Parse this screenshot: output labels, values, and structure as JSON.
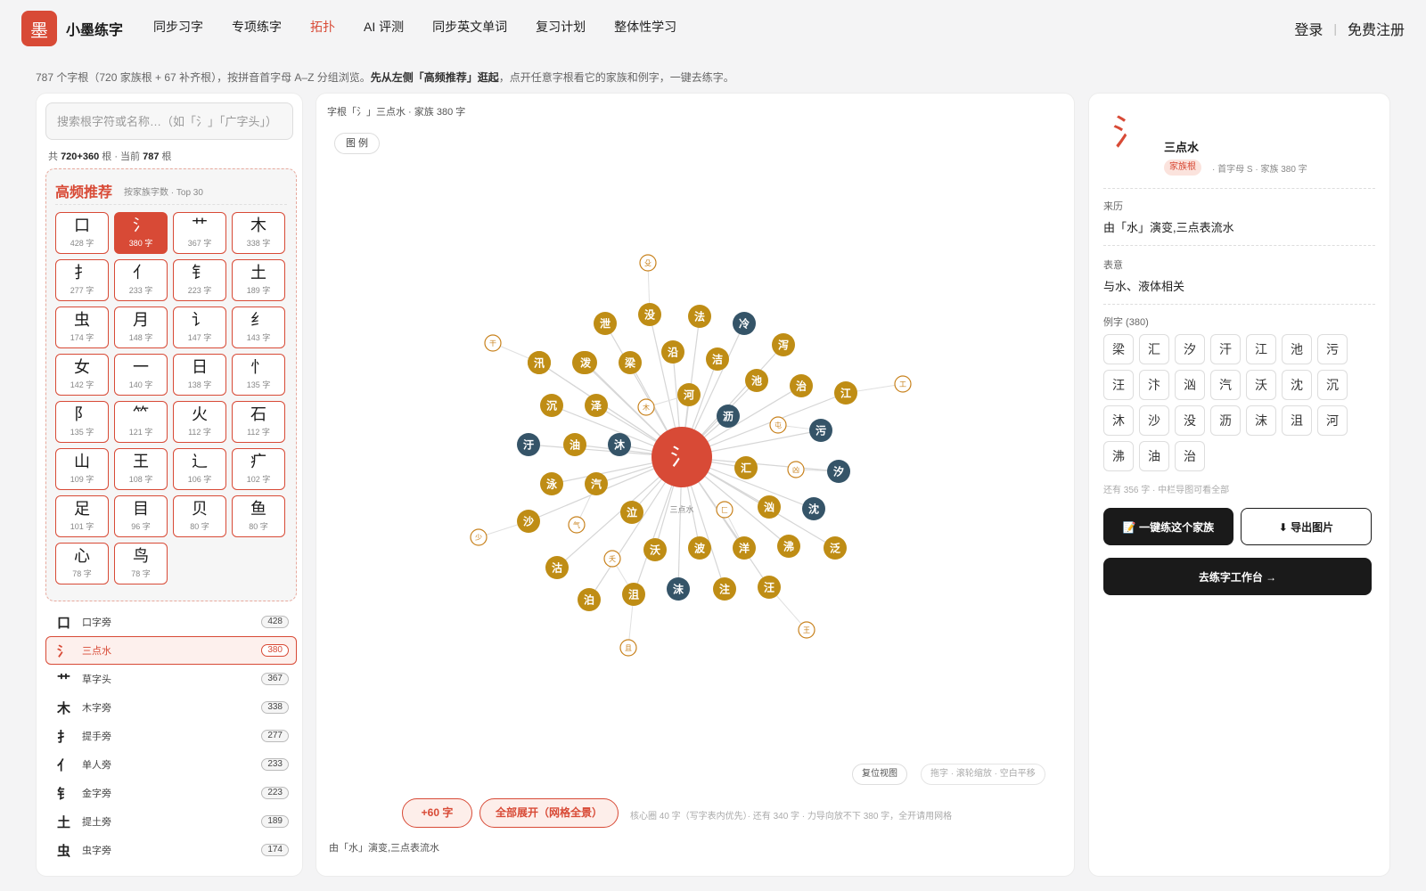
{
  "header": {
    "logo_char": "墨",
    "brand": "小墨练字",
    "nav": [
      "同步习字",
      "专项练字",
      "拓扑",
      "AI 评测",
      "同步英文单词",
      "复习计划",
      "整体性学习"
    ],
    "active_nav": "拓扑",
    "login": "登录",
    "separator": "|",
    "register": "免费注册"
  },
  "intro": {
    "pre": "787 个字根（720 家族根 + 67 补齐根），按拼音首字母 A–Z 分组浏览。",
    "bold": "先从左侧「高频推荐」逛起",
    "post": "，点开任意字根看它的家族和例字，一键去练字。"
  },
  "left": {
    "search_placeholder": "搜索根字符或名称…（如「氵」「广字头」）",
    "count_pre": "共 ",
    "count_total": "720+360",
    "count_mid": " 根 · 当前 ",
    "count_current": "787",
    "count_post": " 根",
    "hot_title": "高频推荐",
    "hot_sub": "按家族字数 · Top 30",
    "hot_items": [
      {
        "ch": "口",
        "count": "428 字"
      },
      {
        "ch": "氵",
        "count": "380 字",
        "selected": true
      },
      {
        "ch": "艹",
        "count": "367 字"
      },
      {
        "ch": "木",
        "count": "338 字"
      },
      {
        "ch": "扌",
        "count": "277 字"
      },
      {
        "ch": "亻",
        "count": "233 字"
      },
      {
        "ch": "钅",
        "count": "223 字"
      },
      {
        "ch": "土",
        "count": "189 字"
      },
      {
        "ch": "虫",
        "count": "174 字"
      },
      {
        "ch": "月",
        "count": "148 字"
      },
      {
        "ch": "讠",
        "count": "147 字"
      },
      {
        "ch": "纟",
        "count": "143 字"
      },
      {
        "ch": "女",
        "count": "142 字"
      },
      {
        "ch": "一",
        "count": "140 字"
      },
      {
        "ch": "日",
        "count": "138 字"
      },
      {
        "ch": "忄",
        "count": "135 字"
      },
      {
        "ch": "阝",
        "count": "135 字"
      },
      {
        "ch": "⺮",
        "count": "121 字"
      },
      {
        "ch": "火",
        "count": "112 字"
      },
      {
        "ch": "石",
        "count": "112 字"
      },
      {
        "ch": "山",
        "count": "109 字"
      },
      {
        "ch": "王",
        "count": "108 字"
      },
      {
        "ch": "辶",
        "count": "106 字"
      },
      {
        "ch": "疒",
        "count": "102 字"
      },
      {
        "ch": "足",
        "count": "101 字"
      },
      {
        "ch": "目",
        "count": "96 字"
      },
      {
        "ch": "贝",
        "count": "80 字"
      },
      {
        "ch": "鱼",
        "count": "80 字"
      },
      {
        "ch": "心",
        "count": "78 字"
      },
      {
        "ch": "鸟",
        "count": "78 字"
      }
    ],
    "radicals": [
      {
        "glyph": "口",
        "name": "口字旁",
        "count": "428"
      },
      {
        "glyph": "氵",
        "name": "三点水",
        "count": "380",
        "selected": true
      },
      {
        "glyph": "艹",
        "name": "草字头",
        "count": "367"
      },
      {
        "glyph": "木",
        "name": "木字旁",
        "count": "338"
      },
      {
        "glyph": "扌",
        "name": "提手旁",
        "count": "277"
      },
      {
        "glyph": "亻",
        "name": "单人旁",
        "count": "233"
      },
      {
        "glyph": "钅",
        "name": "金字旁",
        "count": "223"
      },
      {
        "glyph": "土",
        "name": "提土旁",
        "count": "189"
      },
      {
        "glyph": "虫",
        "name": "虫字旁",
        "count": "174"
      }
    ]
  },
  "center": {
    "breadcrumb": "字根「氵」三点水 · 家族 380 字",
    "legend_btn": "图 例",
    "root_glyph": "氵",
    "root_label": "三点水",
    "colors": {
      "gold": "#bf8d15",
      "navy": "#355468",
      "root": "#d84a36",
      "outline": "#c8821d"
    },
    "nodes": [
      {
        "c": "沿",
        "t": "g"
      },
      {
        "c": "沉",
        "t": "g"
      },
      {
        "c": "汗",
        "t": "g"
      },
      {
        "c": "河",
        "t": "g"
      },
      {
        "c": "池",
        "t": "g"
      },
      {
        "c": "法",
        "t": "g"
      },
      {
        "c": "没",
        "t": "g"
      },
      {
        "c": "泄",
        "t": "g"
      },
      {
        "c": "洁",
        "t": "g"
      },
      {
        "c": "泻",
        "t": "g"
      },
      {
        "c": "冷",
        "t": "n"
      },
      {
        "c": "治",
        "t": "g"
      },
      {
        "c": "江",
        "t": "g"
      },
      {
        "c": "污",
        "t": "n"
      },
      {
        "c": "沥",
        "t": "n"
      },
      {
        "c": "汐",
        "t": "n"
      },
      {
        "c": "汇",
        "t": "g"
      },
      {
        "c": "汹",
        "t": "g"
      },
      {
        "c": "沈",
        "t": "n"
      },
      {
        "c": "沸",
        "t": "g"
      },
      {
        "c": "泛",
        "t": "g"
      },
      {
        "c": "洋",
        "t": "g"
      },
      {
        "c": "汪",
        "t": "g"
      },
      {
        "c": "波",
        "t": "g"
      },
      {
        "c": "注",
        "t": "g"
      },
      {
        "c": "沫",
        "t": "n"
      },
      {
        "c": "沃",
        "t": "g"
      },
      {
        "c": "沮",
        "t": "g"
      },
      {
        "c": "泣",
        "t": "g"
      },
      {
        "c": "泊",
        "t": "g"
      },
      {
        "c": "汽",
        "t": "g"
      },
      {
        "c": "沽",
        "t": "g"
      },
      {
        "c": "沙",
        "t": "g"
      },
      {
        "c": "泳",
        "t": "g"
      },
      {
        "c": "油",
        "t": "g"
      },
      {
        "c": "沐",
        "t": "n"
      },
      {
        "c": "汙",
        "t": "n"
      },
      {
        "c": "泽",
        "t": "g"
      },
      {
        "c": "汛",
        "t": "g"
      },
      {
        "c": "汗",
        "t": "g"
      },
      {
        "c": "泼",
        "t": "g"
      },
      {
        "c": "梁",
        "t": "g"
      }
    ],
    "outline_nodes": [
      "殳",
      "干",
      "木",
      "屯",
      "工",
      "凶",
      "匚",
      "气",
      "少",
      "夭",
      "且",
      "王"
    ],
    "reset_btn": "复位视图",
    "hint": "拖字 · 滚轮缩放 · 空白平移",
    "more_btn": "+60 字",
    "expand_btn": "全部展开（网格全景）",
    "note": "核心圈 40 字（写字表内优先）· 还有 340 字 · 力导向放不下 380 字，全开请用网格",
    "bottom_desc": "由「水」演变,三点表流水"
  },
  "right": {
    "glyph": "氵",
    "name": "三点水",
    "tag": "家族根",
    "meta": "· 首字母 S · 家族 380 字",
    "origin_label": "来历",
    "origin": "由「水」演变,三点表流水",
    "meaning_label": "表意",
    "meaning": "与水、液体相关",
    "examples_label": "例字 (380)",
    "examples": [
      "梁",
      "汇",
      "汐",
      "汗",
      "江",
      "池",
      "污",
      "汪",
      "汴",
      "汹",
      "汽",
      "沃",
      "沈",
      "沉",
      "沐",
      "沙",
      "没",
      "沥",
      "沫",
      "沮",
      "河",
      "沸",
      "油",
      "治"
    ],
    "examples_more": "还有 356 字 · 中栏导图可看全部",
    "practice_btn": "📝 一键练这个家族",
    "export_btn": "⬇ 导出图片",
    "workbench_btn": "去练字工作台 →"
  }
}
